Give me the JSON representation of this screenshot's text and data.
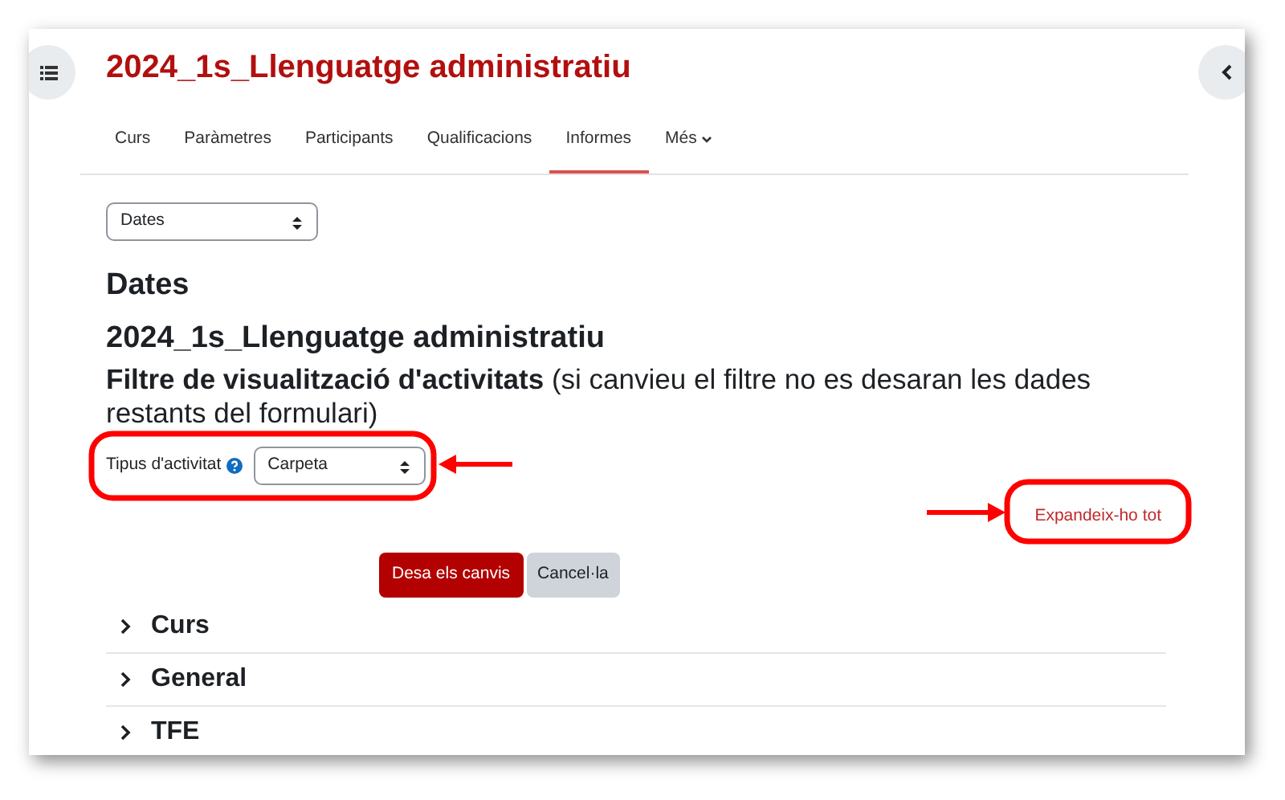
{
  "course_title": "2024_1s_Llenguatge administratiu",
  "tabs": [
    {
      "label": "Curs",
      "selected": false,
      "kind": "link"
    },
    {
      "label": "Paràmetres",
      "selected": false,
      "kind": "link"
    },
    {
      "label": "Participants",
      "selected": false,
      "kind": "link"
    },
    {
      "label": "Qualificacions",
      "selected": false,
      "kind": "link"
    },
    {
      "label": "Informes",
      "selected": true,
      "kind": "link"
    },
    {
      "label": "Més",
      "selected": false,
      "kind": "dropdown"
    }
  ],
  "report_select": {
    "value": "Dates"
  },
  "page_heading": "Dates",
  "course_heading": "2024_1s_Llenguatge administratiu",
  "filter_heading": "**Filtre de visualització d'activitats** (si canvieu el filtre no es desaran les dades restants del formulari)",
  "activity_type": {
    "label": "Tipus d'activitat",
    "value": "Carpeta"
  },
  "expand_all": "Expandeix-ho tot",
  "buttons": [
    {
      "label": "Desa els canvis",
      "kind": "primary"
    },
    {
      "label": "Cancel·la",
      "kind": "secondary"
    }
  ],
  "sections": [
    {
      "title": "Curs",
      "expanded": false
    },
    {
      "title": "General",
      "expanded": false
    },
    {
      "title": "TFE",
      "expanded": false
    }
  ],
  "annotations": [
    {
      "kind": "oval"
    },
    {
      "kind": "arrow-left"
    },
    {
      "kind": "oval"
    },
    {
      "kind": "arrow-right"
    }
  ]
}
